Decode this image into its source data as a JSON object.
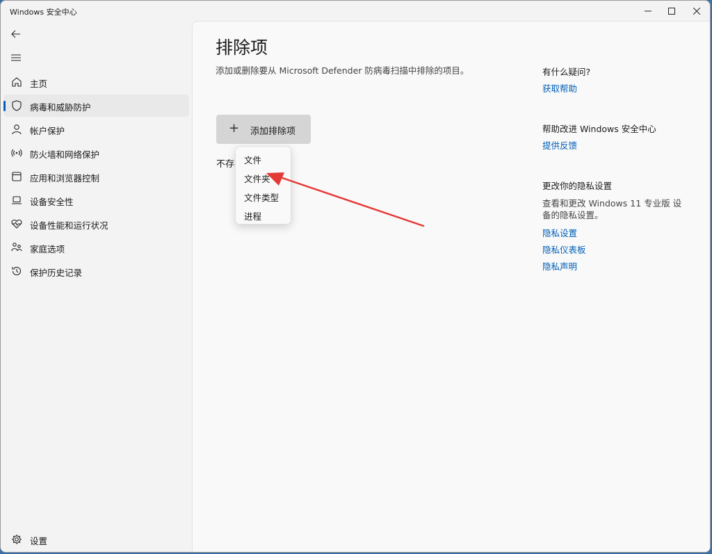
{
  "window": {
    "title": "Windows 安全中心"
  },
  "sidebar": {
    "items": [
      {
        "label": "主页",
        "icon": "home-icon"
      },
      {
        "label": "病毒和威胁防护",
        "icon": "shield-icon",
        "active": true
      },
      {
        "label": "帐户保护",
        "icon": "person-icon"
      },
      {
        "label": "防火墙和网络保护",
        "icon": "wifi-antenna-icon"
      },
      {
        "label": "应用和浏览器控制",
        "icon": "app-window-icon"
      },
      {
        "label": "设备安全性",
        "icon": "laptop-icon"
      },
      {
        "label": "设备性能和运行状况",
        "icon": "heart-pulse-icon"
      },
      {
        "label": "家庭选项",
        "icon": "family-icon"
      },
      {
        "label": "保护历史记录",
        "icon": "history-icon"
      }
    ],
    "settings_label": "设置"
  },
  "main": {
    "title": "排除项",
    "description": "添加或删除要从 Microsoft Defender 防病毒扫描中排除的项目。",
    "add_button_label": "添加排除项",
    "empty_text": "不存在排除项。",
    "dropdown": [
      "文件",
      "文件夹",
      "文件类型",
      "进程"
    ]
  },
  "right": {
    "help_heading": "有什么疑问?",
    "help_link": "获取帮助",
    "improve_heading": "帮助改进 Windows 安全中心",
    "feedback_link": "提供反馈",
    "privacy_heading": "更改你的隐私设置",
    "privacy_text": "查看和更改 Windows 11 专业版 设备的隐私设置。",
    "privacy_links": [
      "隐私设置",
      "隐私仪表板",
      "隐私声明"
    ]
  },
  "colors": {
    "accent": "#005fb8",
    "annotation_arrow": "#e53935"
  }
}
